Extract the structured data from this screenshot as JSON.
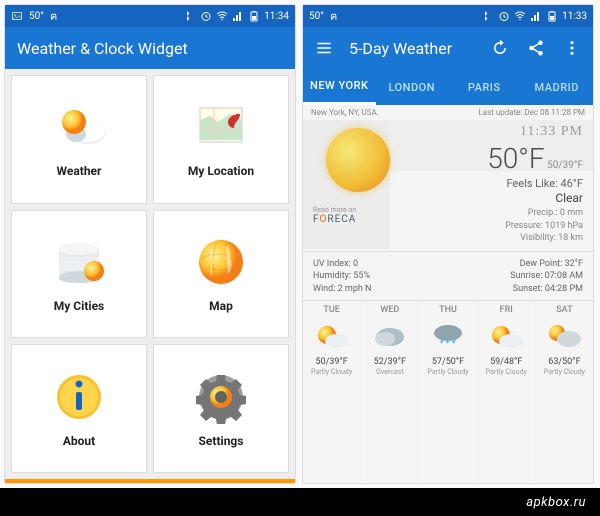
{
  "statusbar_left": {
    "temp_a": "50°",
    "temp_b": "50°"
  },
  "statusbar_right": {
    "time_a": "11:34",
    "time_b": "11:33"
  },
  "screen1": {
    "title": "Weather & Clock Widget",
    "tiles": [
      {
        "label": "Weather",
        "icon": "weather"
      },
      {
        "label": "My Location",
        "icon": "location"
      },
      {
        "label": "My Cities",
        "icon": "cities"
      },
      {
        "label": "Map",
        "icon": "map"
      },
      {
        "label": "About",
        "icon": "about"
      },
      {
        "label": "Settings",
        "icon": "settings"
      }
    ]
  },
  "screen2": {
    "title": "5-Day Weather",
    "tabs": [
      "NEW YORK",
      "LONDON",
      "PARIS",
      "MADRID"
    ],
    "active_tab": 0,
    "location": "New York, NY, USA.",
    "last_update": "Last update: Dec 08  11:28 PM",
    "clock": "11:33 PM",
    "current": {
      "temp": "50°F",
      "hilo": "50/39°F",
      "feels": "Feels Like: 46°F",
      "cond": "Clear",
      "precip": "Precip.: 0 mm",
      "pressure": "Pressure: 1019 hPa",
      "visibility": "Visibility: 18 km"
    },
    "foreca_pre": "Read more on",
    "stats_left": {
      "uv": "UV Index: 0",
      "humidity": "Humidity: 55%",
      "wind": "Wind: 2 mph N"
    },
    "stats_right": {
      "dew": "Dew Point: 32°F",
      "sunrise": "Sunrise: 07:08 AM",
      "sunset": "Sunset: 04:28 PM"
    },
    "forecast": [
      {
        "day": "TUE",
        "icon": "sunny",
        "temp": "50/39°F",
        "cond": "Partly Cloudy"
      },
      {
        "day": "WED",
        "icon": "cloudy",
        "temp": "52/39°F",
        "cond": "Overcast"
      },
      {
        "day": "THU",
        "icon": "rain",
        "temp": "57/50°F",
        "cond": "Partly Cloudy"
      },
      {
        "day": "FRI",
        "icon": "sunny",
        "temp": "59/48°F",
        "cond": "Partly Cloudy"
      },
      {
        "day": "SAT",
        "icon": "suncloud",
        "temp": "63/50°F",
        "cond": "Partly Cloudy"
      }
    ]
  },
  "footer": "apkbox.ru"
}
